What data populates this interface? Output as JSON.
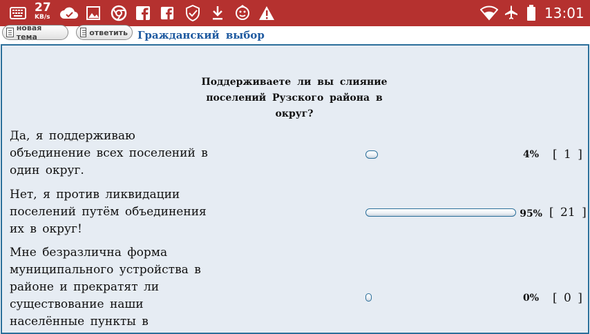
{
  "status_bar": {
    "net_speed_value": "27",
    "net_speed_unit": "KB/s",
    "time": "13:01",
    "icons_left": [
      "keyboard-icon",
      "cloud-check-icon",
      "image-icon",
      "chrome-icon",
      "facebook-icon",
      "facebook-icon",
      "shield-check-icon",
      "download-icon",
      "face-icon",
      "warning-icon"
    ],
    "icons_right": [
      "wifi-icon",
      "airplane-mode-icon",
      "battery-icon"
    ]
  },
  "toolbar": {
    "new_topic_label": "новая тема",
    "reply_label": "ответить",
    "forum_title": "Гражданский выбор"
  },
  "poll": {
    "question": "Поддерживаете ли вы слияние поселений Рузского района в округ?",
    "options": [
      {
        "text": "Да, я поддерживаю объединение всех поселений в один округ.",
        "percent_label": "4%",
        "votes_label": "[ 1 ]",
        "fill_fraction": 0.04
      },
      {
        "text": "Нет, я против ликвидации поселений путём объединения их в округ!",
        "percent_label": "95%",
        "votes_label": "[ 21 ]",
        "fill_fraction": 0.95
      },
      {
        "text": "Мне безразлична форма муниципального устройства в районе и прекратят ли существование наши населённые пункты в",
        "percent_label": "0%",
        "votes_label": "[ 0 ]",
        "fill_fraction": 0.0
      }
    ]
  },
  "colors": {
    "status_bar": "#b5312f",
    "panel_border": "#2b6f9a",
    "panel_bg": "#e6ecf3",
    "link": "#1f5aa0"
  }
}
